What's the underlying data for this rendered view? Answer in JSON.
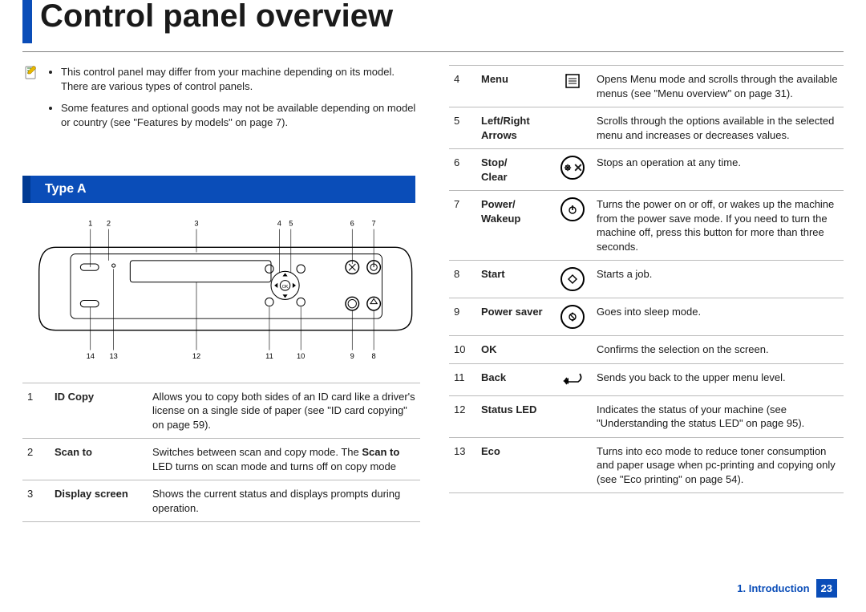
{
  "title": "Control panel overview",
  "notes": [
    "This control panel may differ from your machine depending on its model. There are various types of control panels.",
    "Some features and optional goods may not be available depending on model or country (see \"Features by models\" on page 7)."
  ],
  "type_heading": "Type A",
  "diagram_callouts": [
    "1",
    "2",
    "3",
    "4",
    "5",
    "6",
    "7",
    "8",
    "9",
    "10",
    "11",
    "12",
    "13",
    "14"
  ],
  "diagram_ok_label": "OK",
  "table_left": [
    {
      "num": "1",
      "name": "ID Copy",
      "desc": "Allows you to copy both sides of an ID card like a driver's license on a single side of paper (see \"ID card copying\" on page 59)."
    },
    {
      "num": "2",
      "name": "Scan to",
      "desc_pre": "Switches between scan and copy mode. The ",
      "desc_bold": "Scan to",
      "desc_post": " LED turns on scan mode and turns off on copy mode"
    },
    {
      "num": "3",
      "name": "Display screen",
      "desc": "Shows the current status and displays prompts during operation."
    }
  ],
  "table_right": [
    {
      "num": "4",
      "name": "Menu",
      "icon": "menu",
      "desc": "Opens Menu mode and scrolls through the available menus (see \"Menu overview\" on page 31)."
    },
    {
      "num": "5",
      "name": "Left/Right Arrows",
      "icon": "",
      "desc": "Scrolls through the options available in the selected menu and increases or decreases values."
    },
    {
      "num": "6",
      "name": "Stop/\nClear",
      "icon": "stop",
      "desc": "Stops an operation at any time."
    },
    {
      "num": "7",
      "name": "Power/\nWakeup",
      "icon": "power",
      "desc": "Turns the power on or off, or wakes up the machine from the power save mode. If you need to turn the machine off, press this button for more than three seconds."
    },
    {
      "num": "8",
      "name": "Start",
      "icon": "start",
      "desc": "Starts a job."
    },
    {
      "num": "9",
      "name": "Power saver",
      "icon": "psaver",
      "desc": "Goes into sleep mode."
    },
    {
      "num": "10",
      "name": "OK",
      "icon": "",
      "desc": "Confirms the selection on the screen."
    },
    {
      "num": "11",
      "name": "Back",
      "icon": "back",
      "desc": "Sends you back to the upper menu level."
    },
    {
      "num": "12",
      "name": "Status LED",
      "icon": "",
      "desc": "Indicates the status of your machine (see \"Understanding the status LED\" on page 95)."
    },
    {
      "num": "13",
      "name": "Eco",
      "icon": "",
      "desc": "Turns into eco mode to reduce toner consumption and paper usage when pc-printing and copying only (see \"Eco printing\" on page 54)."
    }
  ],
  "footer": {
    "chapter": "1. Introduction",
    "page": "23"
  }
}
